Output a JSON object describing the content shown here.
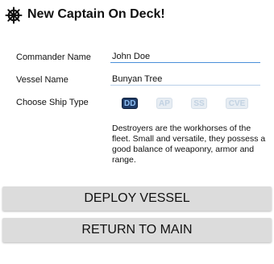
{
  "header": {
    "icon": "ships-wheel-icon",
    "title": "New Captain On Deck!"
  },
  "form": {
    "commander_label": "Commander Name",
    "commander_value": "John Doe",
    "vessel_label": "Vessel Name",
    "vessel_value": "Bunyan Tree",
    "ship_type_label": "Choose Ship Type",
    "ship_types": [
      {
        "label": "DD",
        "selected": true
      },
      {
        "label": "AP",
        "selected": false
      },
      {
        "label": "SS",
        "selected": false
      },
      {
        "label": "CVE",
        "selected": false
      }
    ],
    "description": "Destroyers are the workhorses of the fleet. Small and versatile, they possess a good balance of weaponry, armor and range."
  },
  "actions": {
    "deploy_label": "DEPLOY VESSEL",
    "return_label": "RETURN TO MAIN"
  },
  "colors": {
    "accent": "#4a90d9",
    "selected_badge_bg": "#1f3b66",
    "selected_badge_text": "#8fc1f5",
    "button_bg": "#dcdcdc"
  }
}
